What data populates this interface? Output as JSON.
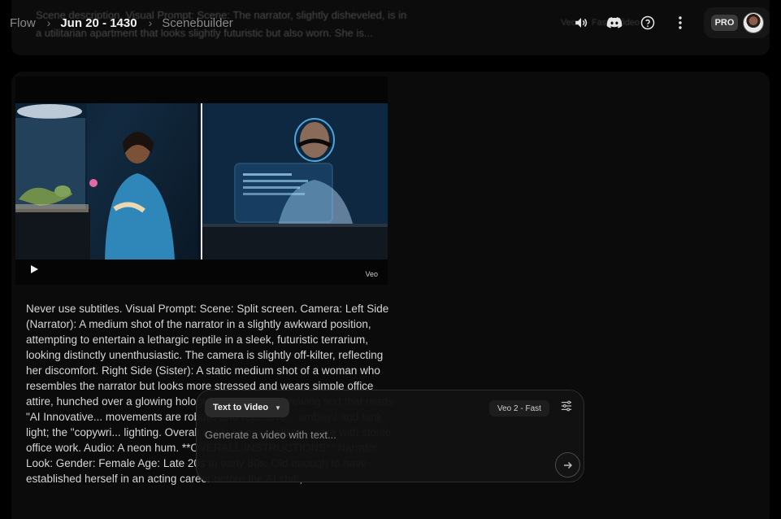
{
  "header": {
    "breadcrumb": [
      {
        "label": "Flow"
      },
      {
        "label": "Jun 20 - 1430"
      },
      {
        "label": "Scenebuilder"
      }
    ],
    "separator": "›",
    "ghost_text": "Scene description. Visual Prompt: Scene: The narrator, slightly disheveled, is in a utilitarian apartment that looks slightly futuristic but also worn. She is...",
    "ghost_right": "Veo 2 · Fast · Video",
    "icons": [
      "volume-icon",
      "discord-icon",
      "help-icon",
      "more-vert-icon"
    ],
    "pro_badge": "PRO"
  },
  "video": {
    "watermark": "Veo",
    "controls": [
      "play-icon"
    ]
  },
  "prompt_text": "Never use subtitles. Visual Prompt: Scene: Split screen. Camera: Left Side (Narrator): A medium shot of the narrator in a slightly awkward position, attempting to entertain a lethargic reptile in a sleek, futuristic terrarium, looking distinctly unenthusiastic. The camera is slightly off-kilter, reflecting her discomfort. Right Side (Sister): A static medium shot of a woman who resembles the narrator but looks more stressed and wears simple office attire, hunched over a glowing holographic screen, reviewing text that reads \"AI Innovative... movements are robotic and repetitive... ambient and tank light; the \"copywri... lighting. Overall Look: Hyper-realistic... care with sterile office work. Audio: A neon hum. **OVERALL INSTRUCTIONS** Narrator Look: Gender: Female Age: Late 20s to early 30s. Old enough to have established herself in an acting career before the AI shift,",
  "composer": {
    "mode_label": "Text to Video",
    "model_label": "Veo 2 - Fast",
    "placeholder": "Generate a video with text..."
  },
  "colors": {
    "background": "#000000",
    "card": "#0b0b0b",
    "composer": "#121212",
    "pro_badge": "#3a3a3a"
  }
}
